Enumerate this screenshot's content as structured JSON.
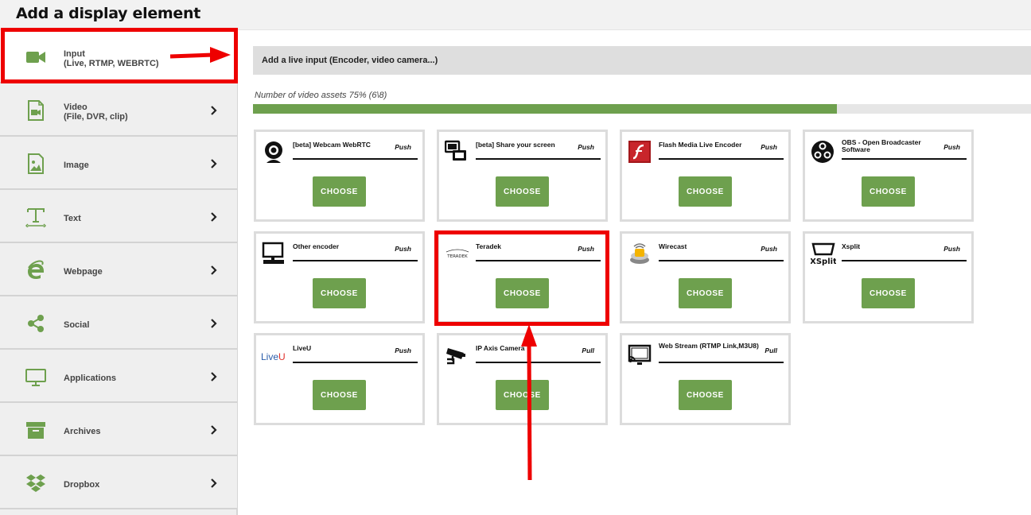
{
  "page": {
    "title": "Add a display element"
  },
  "sidebar": {
    "items": [
      {
        "line1": "Input",
        "line2": "(Live, RTMP, WEBRTC)",
        "icon": "video-camera-icon"
      },
      {
        "line1": "Video",
        "line2": "(File, DVR, clip)",
        "icon": "video-file-icon"
      },
      {
        "line1": "Image",
        "line2": "",
        "icon": "image-icon"
      },
      {
        "line1": "Text",
        "line2": "",
        "icon": "text-icon"
      },
      {
        "line1": "Webpage",
        "line2": "",
        "icon": "internet-explorer-icon"
      },
      {
        "line1": "Social",
        "line2": "",
        "icon": "share-icon"
      },
      {
        "line1": "Applications",
        "line2": "",
        "icon": "monitor-icon"
      },
      {
        "line1": "Archives",
        "line2": "",
        "icon": "archive-box-icon"
      },
      {
        "line1": "Dropbox",
        "line2": "",
        "icon": "dropbox-icon"
      }
    ]
  },
  "main": {
    "section_title": "Add a live input (Encoder, video camera...)",
    "assets_text": "Number of video assets 75% (6\\8)",
    "assets_progress": 0.75,
    "choose_label": "CHOOSE",
    "cards": [
      {
        "title": "[beta] Webcam WebRTC",
        "type": "Push",
        "icon": "webcam-icon"
      },
      {
        "title": "[beta] Share your screen",
        "type": "Push",
        "icon": "screen-share-icon"
      },
      {
        "title": "Flash Media Live Encoder",
        "type": "Push",
        "icon": "flash-icon"
      },
      {
        "title": "OBS - Open Broadcaster Software",
        "type": "Push",
        "icon": "obs-icon"
      },
      {
        "title": "Other encoder",
        "type": "Push",
        "icon": "computer-icon"
      },
      {
        "title": "Teradek",
        "type": "Push",
        "icon": "teradek-logo-icon"
      },
      {
        "title": "Wirecast",
        "type": "Push",
        "icon": "wirecast-icon"
      },
      {
        "title": "Xsplit",
        "type": "Push",
        "icon": "xsplit-icon"
      },
      {
        "title": "LiveU",
        "type": "Push",
        "icon": "liveu-logo-icon"
      },
      {
        "title": "IP Axis Camera",
        "type": "Pull",
        "icon": "security-camera-icon"
      },
      {
        "title": "Web Stream (RTMP Link,M3U8)",
        "type": "Pull",
        "icon": "cast-screen-icon"
      }
    ]
  },
  "logos": {
    "xsplit": "XSplit",
    "liveu_a": "Live",
    "liveu_b": "U",
    "teradek": "TERADEK"
  },
  "colors": {
    "accent_green": "#6ea04e",
    "annotation_red": "#ee0000"
  }
}
